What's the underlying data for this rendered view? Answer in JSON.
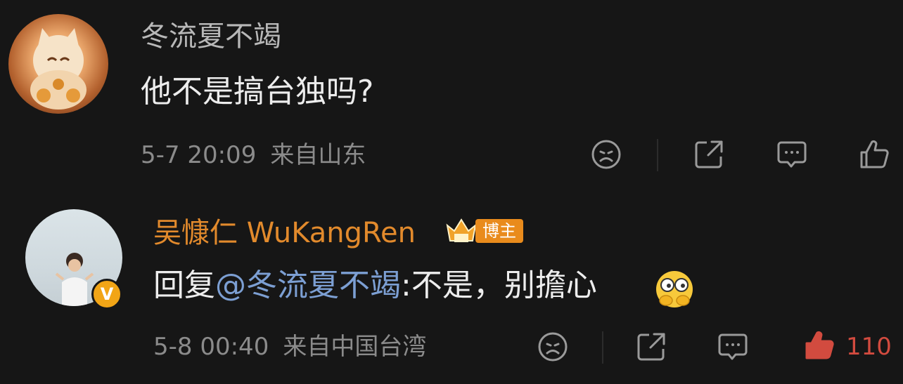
{
  "comment1": {
    "author": "冬流夏不竭",
    "text": "他不是搞台独吗?",
    "date": "5-7 20:09",
    "location": "来自山东",
    "actions": [
      "dislike-icon",
      "share-icon",
      "comment-icon",
      "like-icon"
    ]
  },
  "reply": {
    "author": "吴慷仁 WuKangRen",
    "badge": "博主",
    "prefix": "回复",
    "mention": "@冬流夏不竭",
    "text": ":不是，别擔心",
    "emoji": "peeking-eyes-emoji",
    "date": "5-8 00:40",
    "location": "来自中国台湾",
    "like_count": "110",
    "verified_badge": "V",
    "actions": [
      "dislike-icon",
      "share-icon",
      "comment-icon",
      "like-icon"
    ]
  },
  "colors": {
    "background": "#161616",
    "author_name": "#b8b8b8",
    "blogger_name": "#e28a2c",
    "mention": "#7c9fd3",
    "meta": "#8b8b8b",
    "liked": "#d24b3f",
    "badge": "#e98b1c"
  }
}
